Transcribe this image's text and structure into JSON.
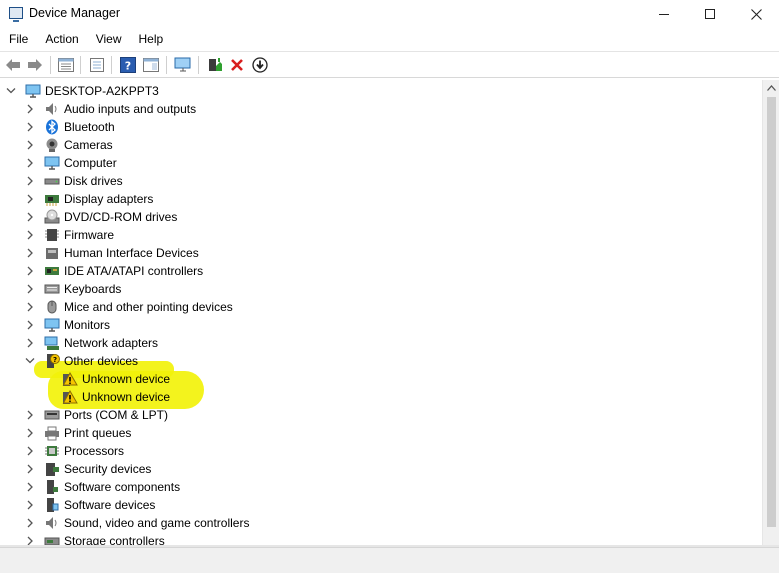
{
  "window": {
    "title": "Device Manager"
  },
  "menu": [
    "File",
    "Action",
    "View",
    "Help"
  ],
  "toolbar_icons": [
    "back-arrow-icon",
    "forward-arrow-icon",
    "properties-list-icon",
    "show-hide-tree-icon",
    "help-icon",
    "action-pane-icon",
    "monitor-scan-icon",
    "update-driver-icon",
    "uninstall-icon",
    "download-driver-icon"
  ],
  "tree": {
    "root": "DESKTOP-A2KPPT3",
    "categories": [
      {
        "label": "Audio inputs and outputs",
        "icon": "speaker-icon",
        "expanded": false
      },
      {
        "label": "Bluetooth",
        "icon": "bluetooth-icon",
        "expanded": false
      },
      {
        "label": "Cameras",
        "icon": "camera-icon",
        "expanded": false
      },
      {
        "label": "Computer",
        "icon": "computer-icon",
        "expanded": false
      },
      {
        "label": "Disk drives",
        "icon": "disk-drive-icon",
        "expanded": false
      },
      {
        "label": "Display adapters",
        "icon": "display-adapter-icon",
        "expanded": false
      },
      {
        "label": "DVD/CD-ROM drives",
        "icon": "dvd-drive-icon",
        "expanded": false
      },
      {
        "label": "Firmware",
        "icon": "firmware-icon",
        "expanded": false
      },
      {
        "label": "Human Interface Devices",
        "icon": "hid-icon",
        "expanded": false
      },
      {
        "label": "IDE ATA/ATAPI controllers",
        "icon": "ide-controller-icon",
        "expanded": false
      },
      {
        "label": "Keyboards",
        "icon": "keyboard-icon",
        "expanded": false
      },
      {
        "label": "Mice and other pointing devices",
        "icon": "mouse-icon",
        "expanded": false
      },
      {
        "label": "Monitors",
        "icon": "monitor-icon",
        "expanded": false
      },
      {
        "label": "Network adapters",
        "icon": "network-adapter-icon",
        "expanded": false
      },
      {
        "label": "Other devices",
        "icon": "unknown-device-category-icon",
        "expanded": true,
        "children": [
          {
            "label": "Unknown device",
            "icon": "warning-device-icon"
          },
          {
            "label": "Unknown device",
            "icon": "warning-device-icon"
          }
        ]
      },
      {
        "label": "Ports (COM & LPT)",
        "icon": "port-icon",
        "expanded": false
      },
      {
        "label": "Print queues",
        "icon": "printer-icon",
        "expanded": false
      },
      {
        "label": "Processors",
        "icon": "processor-icon",
        "expanded": false
      },
      {
        "label": "Security devices",
        "icon": "security-device-icon",
        "expanded": false
      },
      {
        "label": "Software components",
        "icon": "software-component-icon",
        "expanded": false
      },
      {
        "label": "Software devices",
        "icon": "software-device-icon",
        "expanded": false
      },
      {
        "label": "Sound, video and game controllers",
        "icon": "sound-controller-icon",
        "expanded": false
      },
      {
        "label": "Storage controllers",
        "icon": "storage-controller-icon",
        "expanded": false
      }
    ]
  },
  "colors": {
    "highlight": "#f2f20a",
    "accent": "#1a73d9",
    "warning": "#f5c400",
    "error": "#d81e1e"
  }
}
